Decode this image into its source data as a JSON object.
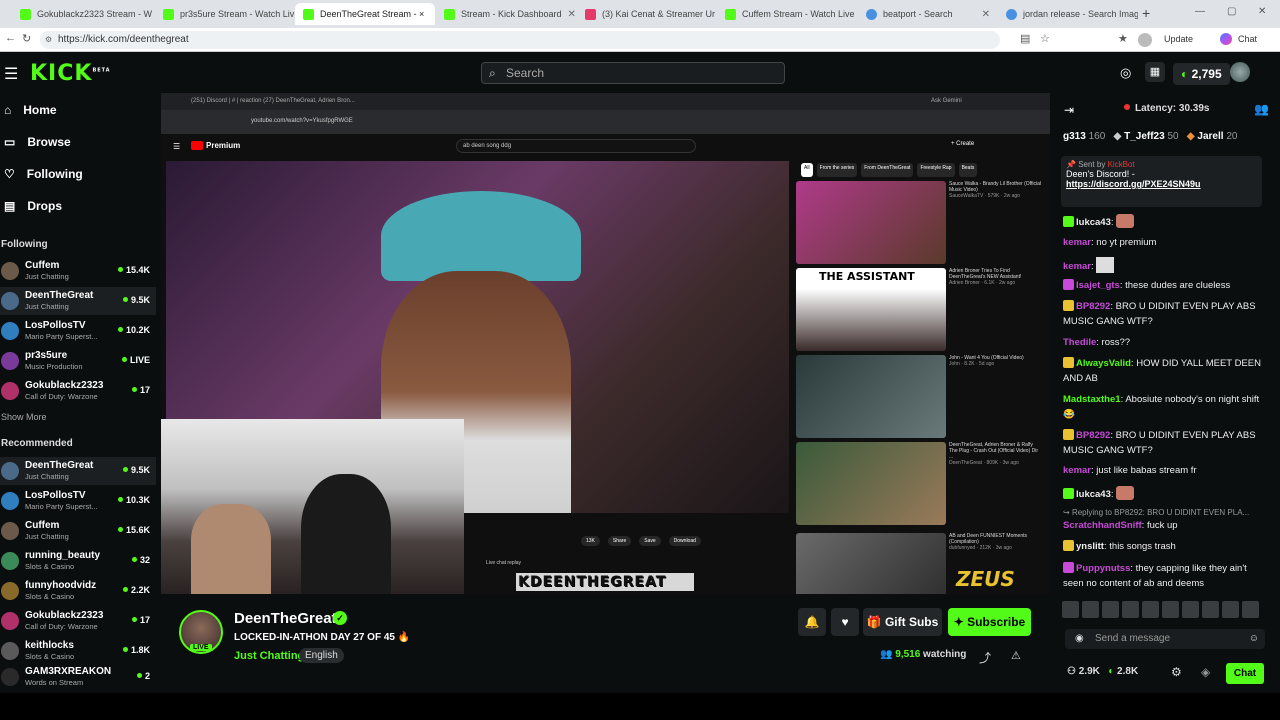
{
  "browser": {
    "tabs": [
      "Gokublackz2323 Stream - W",
      "pr3s5ure Stream - Watch Liv",
      "DeenTheGreat Stream - ×",
      "Stream - Kick Dashboard",
      "(3) Kai Cenat & Streamer Ur",
      "Cuffem Stream - Watch Live",
      "beatport - Search",
      "jordan release - Search Imag"
    ],
    "url": "https://kick.com/deenthegreat",
    "update": "Update",
    "chat": "Chat"
  },
  "header": {
    "logo": "KICK",
    "beta": "BETA",
    "search_placeholder": "Search",
    "coins": "2,795"
  },
  "sidebar": {
    "nav": [
      "Home",
      "Browse",
      "Following",
      "Drops"
    ],
    "following_title": "Following",
    "following": [
      {
        "name": "Cuffem",
        "cat": "Just Chatting",
        "viewers": "15.4K"
      },
      {
        "name": "DeenTheGreat",
        "cat": "Just Chatting",
        "viewers": "9.5K"
      },
      {
        "name": "LosPollosTV",
        "cat": "Mario Party Superst...",
        "viewers": "10.2K"
      },
      {
        "name": "pr3s5ure",
        "cat": "Music Production",
        "viewers": "LIVE"
      },
      {
        "name": "Gokublackz2323",
        "cat": "Call of Duty: Warzone",
        "viewers": "17"
      }
    ],
    "show_more": "Show More",
    "recommended_title": "Recommended",
    "recommended": [
      {
        "name": "DeenTheGreat",
        "cat": "Just Chatting",
        "viewers": "9.5K"
      },
      {
        "name": "LosPollosTV",
        "cat": "Mario Party Superst...",
        "viewers": "10.3K"
      },
      {
        "name": "Cuffem",
        "cat": "Just Chatting",
        "viewers": "15.6K"
      },
      {
        "name": "running_beauty",
        "cat": "Slots & Casino",
        "viewers": "32"
      },
      {
        "name": "funnyhoodvidz",
        "cat": "Slots & Casino",
        "viewers": "2.2K"
      },
      {
        "name": "Gokublackz2323",
        "cat": "Call of Duty: Warzone",
        "viewers": "17"
      },
      {
        "name": "keithlocks",
        "cat": "Slots & Casino",
        "viewers": "1.8K"
      },
      {
        "name": "GAM3RXREAKON",
        "cat": "Words on Stream",
        "viewers": "2"
      }
    ]
  },
  "player": {
    "yt_tabs": "(251) Discord | #  |  reaction    (27) DeenTheGreat, Adrien Bron...",
    "yt_url": "youtube.com/watch?v=YkusfpgRWGE",
    "yt_search": "ab deen song ddg",
    "yt_logo": "Premium",
    "ask_gemini": "Ask Gemini",
    "yt_create": "+ Create",
    "chips": [
      "All",
      "From the series",
      "From DeenTheGreat",
      "Freestyle Rap",
      "Beats"
    ],
    "side_videos": [
      {
        "title": "Sauce Walka - Brandy Lil Brother (Official Music Video)",
        "meta": "SauceWalkaTV · 579K · 2w ago"
      },
      {
        "title": "Adrien Broner Tries To Find DeenTheGreat's NEW Assistant!",
        "meta": "Adrien Broner · 6.1K · 2w ago"
      },
      {
        "title": "John - Want 4 You (Official Video)",
        "meta": "John · 8.2K · 5d ago"
      },
      {
        "title": "DeenTheGreat, Adrien Broner & Ralfy The Plug - Crash Out (Official Video) Dir ...",
        "meta": "DeenTheGreat · 809K · 3w ago"
      },
      {
        "title": "AB and Deen FUNNIEST Moments (Compilation)",
        "meta": "dubfunnyed · 212K · 3w ago"
      }
    ],
    "thumb_text": "THE ASSISTANT",
    "yt_actions": [
      "13K",
      "Share",
      "Save",
      "Download"
    ],
    "live_replay": "Live chat replay",
    "overlay_name": "KDEENTHEGREAT",
    "sponsor": "ZEUS"
  },
  "info": {
    "name": "DeenTheGreat",
    "title": "LOCKED-IN-ATHON DAY 27 OF 45 🔥",
    "category": "Just Chatting",
    "language": "English",
    "live": "LIVE",
    "gift": "Gift Subs",
    "subscribe": "Subscribe",
    "watching": "9,516",
    "watching_label": "watching"
  },
  "chat": {
    "latency": "Latency: 30.39s",
    "gifters": [
      {
        "u": "g313",
        "n": "160"
      },
      {
        "u": "T_Jeff23",
        "n": "50"
      },
      {
        "u": "Jarell",
        "n": "20"
      }
    ],
    "pinned": {
      "sent_by": "Sent by",
      "bot": "KickBot",
      "text": "Deen's Discord! -",
      "link": "https://discord.gg/PXE24SN49u"
    },
    "messages": [
      {
        "u": "lukca43",
        "t": "",
        "c": "#ffffff"
      },
      {
        "u": "kemar",
        "t": "no yt premium",
        "c": "#c84ad8"
      },
      {
        "u": "kemar",
        "t": "",
        "c": "#c84ad8"
      },
      {
        "u": "Isajet_gts",
        "t": "these dudes are clueless",
        "c": "#c84ad8"
      },
      {
        "u": "BP8292",
        "t": "BRO U DIDINT EVEN PLAY ABS MUSIC GANG WTF?",
        "c": "#c84ad8"
      },
      {
        "u": "Thedile",
        "t": "ross??",
        "c": "#c84ad8"
      },
      {
        "u": "AlwaysValid",
        "t": "HOW DID YALL MEET DEEN AND AB",
        "c": "#53fc18"
      },
      {
        "u": "Madstaxthe1",
        "t": "Abosiute nobody's on night shift 😂",
        "c": "#53fc18"
      },
      {
        "u": "BP8292",
        "t": "BRO U DIDINT EVEN PLAY ABS MUSIC GANG WTF?",
        "c": "#c84ad8"
      },
      {
        "u": "kemar",
        "t": "just like babas stream fr",
        "c": "#c84ad8"
      },
      {
        "u": "lukca43",
        "t": "",
        "c": "#ffffff"
      },
      {
        "u": "ScratchhandSniff",
        "t": "fuck up",
        "c": "#c84ad8"
      },
      {
        "u": "ynslitt",
        "t": "this songs trash",
        "c": "#ffffff"
      },
      {
        "u": "Puppynutss",
        "t": "they capping like they ain't seen no content of ab and deems",
        "c": "#c84ad8"
      }
    ],
    "reply": "Replying to BP8292: BRO U DIDINT EVEN PLA...",
    "send_placeholder": "Send a message",
    "stats_a": "2.9K",
    "stats_b": "2.8K",
    "chat_btn": "Chat"
  }
}
